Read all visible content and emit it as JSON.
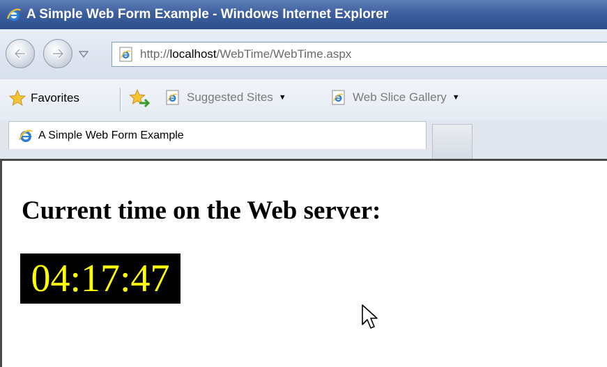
{
  "window": {
    "title": "A Simple Web Form Example - Windows Internet Explorer"
  },
  "address_bar": {
    "url_prefix": "http://",
    "url_host": "localhost",
    "url_path": "/WebTime/WebTime.aspx"
  },
  "favorites_bar": {
    "favorites_label": "Favorites",
    "items": [
      {
        "label": "Suggested Sites",
        "icon": "ie-page-icon"
      },
      {
        "label": "Web Slice Gallery",
        "icon": "ie-page-icon"
      }
    ]
  },
  "tabs": [
    {
      "label": "A Simple Web Form Example",
      "active": true
    }
  ],
  "page": {
    "heading": "Current time on the Web server:",
    "time_value": "04:17:47",
    "time_colors": {
      "background": "#000000",
      "text": "#ffff00"
    }
  },
  "colors": {
    "titlebar": "#3e5f9e",
    "chrome": "#dfe6f1"
  }
}
